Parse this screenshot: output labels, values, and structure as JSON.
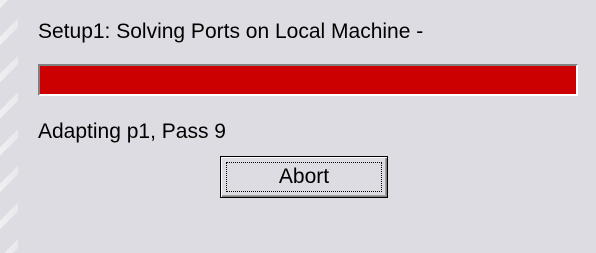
{
  "dialog": {
    "status_title": "Setup1: Solving Ports on Local Machine -",
    "progress_fraction": 1.0,
    "progress_color": "#cc0000",
    "step_text": "Adapting p1, Pass 9",
    "abort_label": "Abort"
  }
}
